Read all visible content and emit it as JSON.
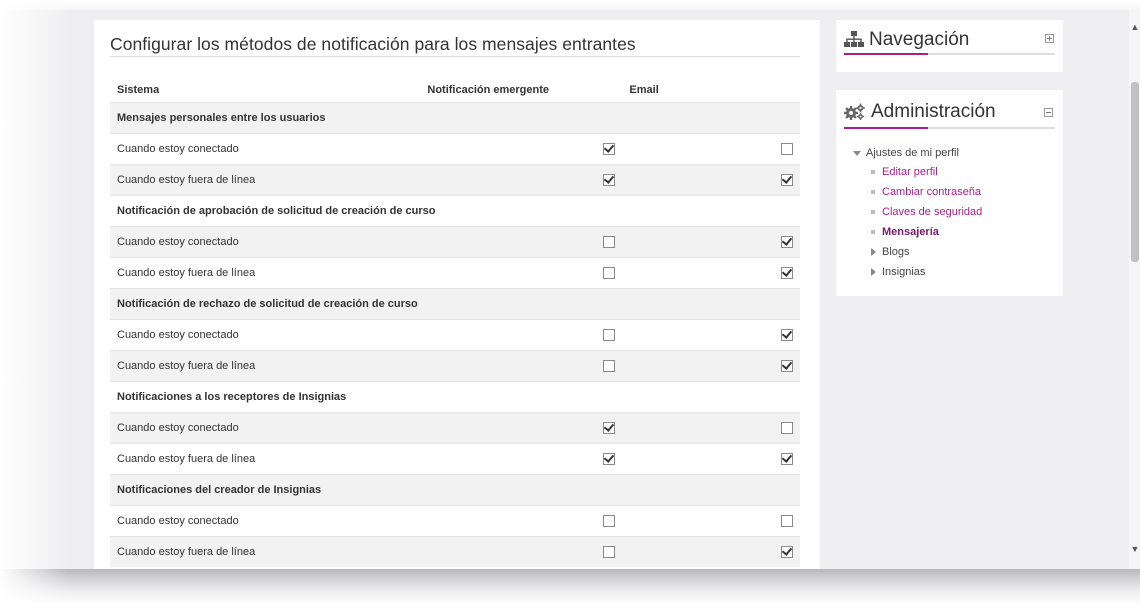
{
  "main": {
    "title": "Configurar los métodos de notificación para los mensajes entrantes",
    "columns": {
      "system": "Sistema",
      "popup": "Notificación emergente",
      "email": "Email"
    },
    "rows": [
      {
        "type": "section",
        "label": "Mensajes personales entre los usuarios"
      },
      {
        "type": "item",
        "label": "Cuando estoy conectado",
        "popup": true,
        "email": false
      },
      {
        "type": "item",
        "label": "Cuando estoy fuera de línea",
        "popup": true,
        "email": true
      },
      {
        "type": "section",
        "label": "Notificación de aprobación de solicitud de creación de curso"
      },
      {
        "type": "item",
        "label": "Cuando estoy conectado",
        "popup": false,
        "email": true
      },
      {
        "type": "item",
        "label": "Cuando estoy fuera de línea",
        "popup": false,
        "email": true
      },
      {
        "type": "section",
        "label": "Notificación de rechazo de solicitud de creación de curso"
      },
      {
        "type": "item",
        "label": "Cuando estoy conectado",
        "popup": false,
        "email": true
      },
      {
        "type": "item",
        "label": "Cuando estoy fuera de línea",
        "popup": false,
        "email": true
      },
      {
        "type": "section",
        "label": "Notificaciones a los receptores de Insignias"
      },
      {
        "type": "item",
        "label": "Cuando estoy conectado",
        "popup": true,
        "email": false
      },
      {
        "type": "item",
        "label": "Cuando estoy fuera de línea",
        "popup": true,
        "email": true
      },
      {
        "type": "section",
        "label": "Notificaciones del creador de Insignias"
      },
      {
        "type": "item",
        "label": "Cuando estoy conectado",
        "popup": false,
        "email": false
      },
      {
        "type": "item",
        "label": "Cuando estoy fuera de línea",
        "popup": false,
        "email": true
      }
    ]
  },
  "navigation": {
    "title": "Navegación",
    "icon": "sitemap-icon"
  },
  "administration": {
    "title": "Administración",
    "icon": "cogs-icon",
    "tree": {
      "root": "Ajustes de mi perfil",
      "items": [
        {
          "label": "Editar perfil",
          "kind": "link"
        },
        {
          "label": "Cambiar contraseña",
          "kind": "link"
        },
        {
          "label": "Claves de seguridad",
          "kind": "link"
        },
        {
          "label": "Mensajería",
          "kind": "current"
        },
        {
          "label": "Blogs",
          "kind": "collapsed"
        },
        {
          "label": "Insignias",
          "kind": "collapsed"
        }
      ]
    }
  },
  "colors": {
    "accent": "#a8208f",
    "shade": "#f2f2f2",
    "page_bg": "#efeff1"
  }
}
